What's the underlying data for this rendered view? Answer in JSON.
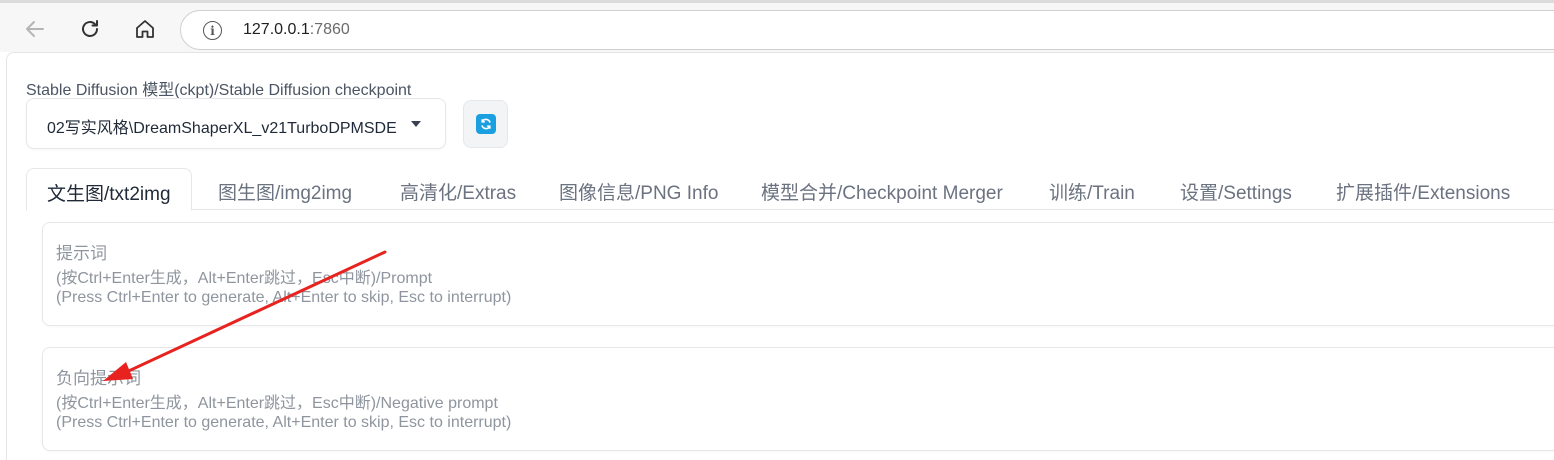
{
  "browser": {
    "url_host": "127.0.0.1",
    "url_port": ":7860",
    "info_icon_glyph": "i"
  },
  "checkpoint": {
    "label": "Stable Diffusion 模型(ckpt)/Stable Diffusion checkpoint",
    "selected": "02写实风格\\DreamShaperXL_v21TurboDPMSDE"
  },
  "tabs": [
    {
      "label": "文生图/txt2img",
      "active": true
    },
    {
      "label": "图生图/img2img",
      "active": false
    },
    {
      "label": "高清化/Extras",
      "active": false
    },
    {
      "label": "图像信息/PNG Info",
      "active": false
    },
    {
      "label": "模型合并/Checkpoint Merger",
      "active": false
    },
    {
      "label": "训练/Train",
      "active": false
    },
    {
      "label": "设置/Settings",
      "active": false
    },
    {
      "label": "扩展插件/Extensions",
      "active": false
    }
  ],
  "prompt": {
    "line1": "提示词",
    "line2": "(按Ctrl+Enter生成，Alt+Enter跳过，Esc中断)/Prompt",
    "line3": "(Press Ctrl+Enter to generate, Alt+Enter to skip, Esc to interrupt)"
  },
  "negative_prompt": {
    "line1": "负向提示词",
    "line2": "(按Ctrl+Enter生成，Alt+Enter跳过，Esc中断)/Negative prompt",
    "line3": "(Press Ctrl+Enter to generate, Alt+Enter to skip, Esc to interrupt)"
  },
  "colors": {
    "accent_blue": "#1a9fe0",
    "annotation_red": "#e8231f"
  }
}
